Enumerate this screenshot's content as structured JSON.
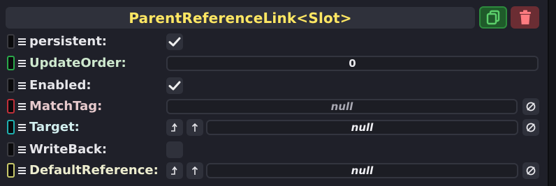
{
  "component": {
    "title": "ParentReferenceLink<Slot>",
    "duplicate_icon": "duplicate-icon",
    "delete_icon": "trash-icon"
  },
  "fields": [
    {
      "label": "persistent:",
      "type": "checkbox",
      "checked": true,
      "handle_color": "#3a3a40",
      "label_color": "#e6e6ea"
    },
    {
      "label": "UpdateOrder:",
      "type": "number",
      "value": "0",
      "handle_color": "#2aa84a",
      "label_color": "#cfe9cf"
    },
    {
      "label": "Enabled:",
      "type": "checkbox",
      "checked": true,
      "handle_color": "#3a3a40",
      "label_color": "#e6e6ea"
    },
    {
      "label": "MatchTag:",
      "type": "text",
      "value": "null",
      "handle_color": "#c0303a",
      "label_color": "#e6c9cc"
    },
    {
      "label": "Target:",
      "type": "reference",
      "value": "null",
      "handle_color": "#1fb0b0",
      "label_color": "#d2eeee"
    },
    {
      "label": "WriteBack:",
      "type": "checkbox",
      "checked": false,
      "handle_color": "#3a3a40",
      "label_color": "#e6e6ea"
    },
    {
      "label": "DefaultReference:",
      "type": "reference",
      "value": "null",
      "handle_color": "#c8c86a",
      "label_color": "#ededcf"
    }
  ]
}
